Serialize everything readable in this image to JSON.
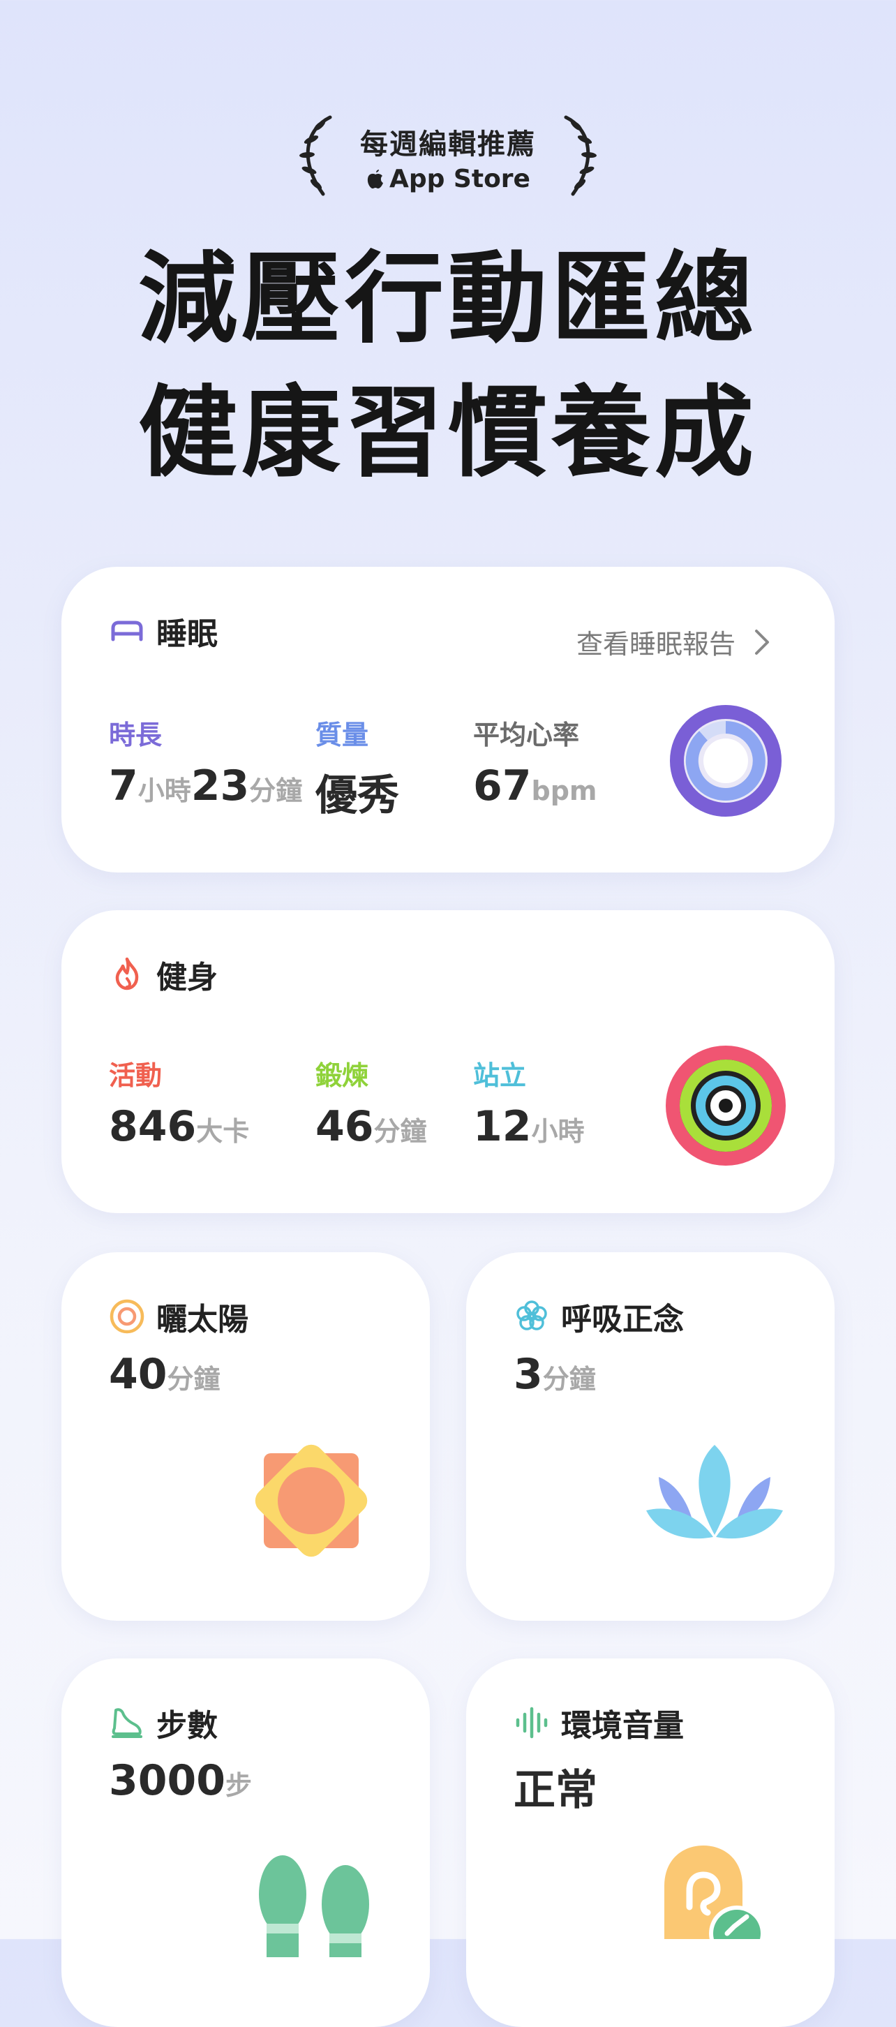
{
  "badge": {
    "title": "每週編輯推薦",
    "store": "App Store"
  },
  "headline": {
    "line1": "減壓行動匯總",
    "line2": "健康習慣養成"
  },
  "sleep": {
    "title": "睡眠",
    "link": "查看睡眠報告",
    "duration": {
      "label": "時長",
      "hours": "7",
      "hours_unit": "小時",
      "minutes": "23",
      "minutes_unit": "分鐘"
    },
    "quality": {
      "label": "質量",
      "value": "優秀"
    },
    "heart_rate": {
      "label": "平均心率",
      "value": "67",
      "unit": "bpm"
    },
    "colors": {
      "duration": "#7b6bd8",
      "quality": "#6a8ee8",
      "heart_rate": "#6b6b6b"
    }
  },
  "fitness": {
    "title": "健身",
    "activity": {
      "label": "活動",
      "value": "846",
      "unit": "大卡"
    },
    "exercise": {
      "label": "鍛煉",
      "value": "46",
      "unit": "分鐘"
    },
    "stand": {
      "label": "站立",
      "value": "12",
      "unit": "小時"
    },
    "colors": {
      "activity": "#f0604f",
      "exercise": "#8fd23a",
      "stand": "#4fbfd9"
    }
  },
  "sun": {
    "title": "曬太陽",
    "value": "40",
    "unit": "分鐘"
  },
  "breath": {
    "title": "呼吸正念",
    "value": "3",
    "unit": "分鐘"
  },
  "steps": {
    "title": "步數",
    "value": "3000",
    "unit": "步"
  },
  "noise": {
    "title": "環境音量",
    "value": "正常"
  }
}
